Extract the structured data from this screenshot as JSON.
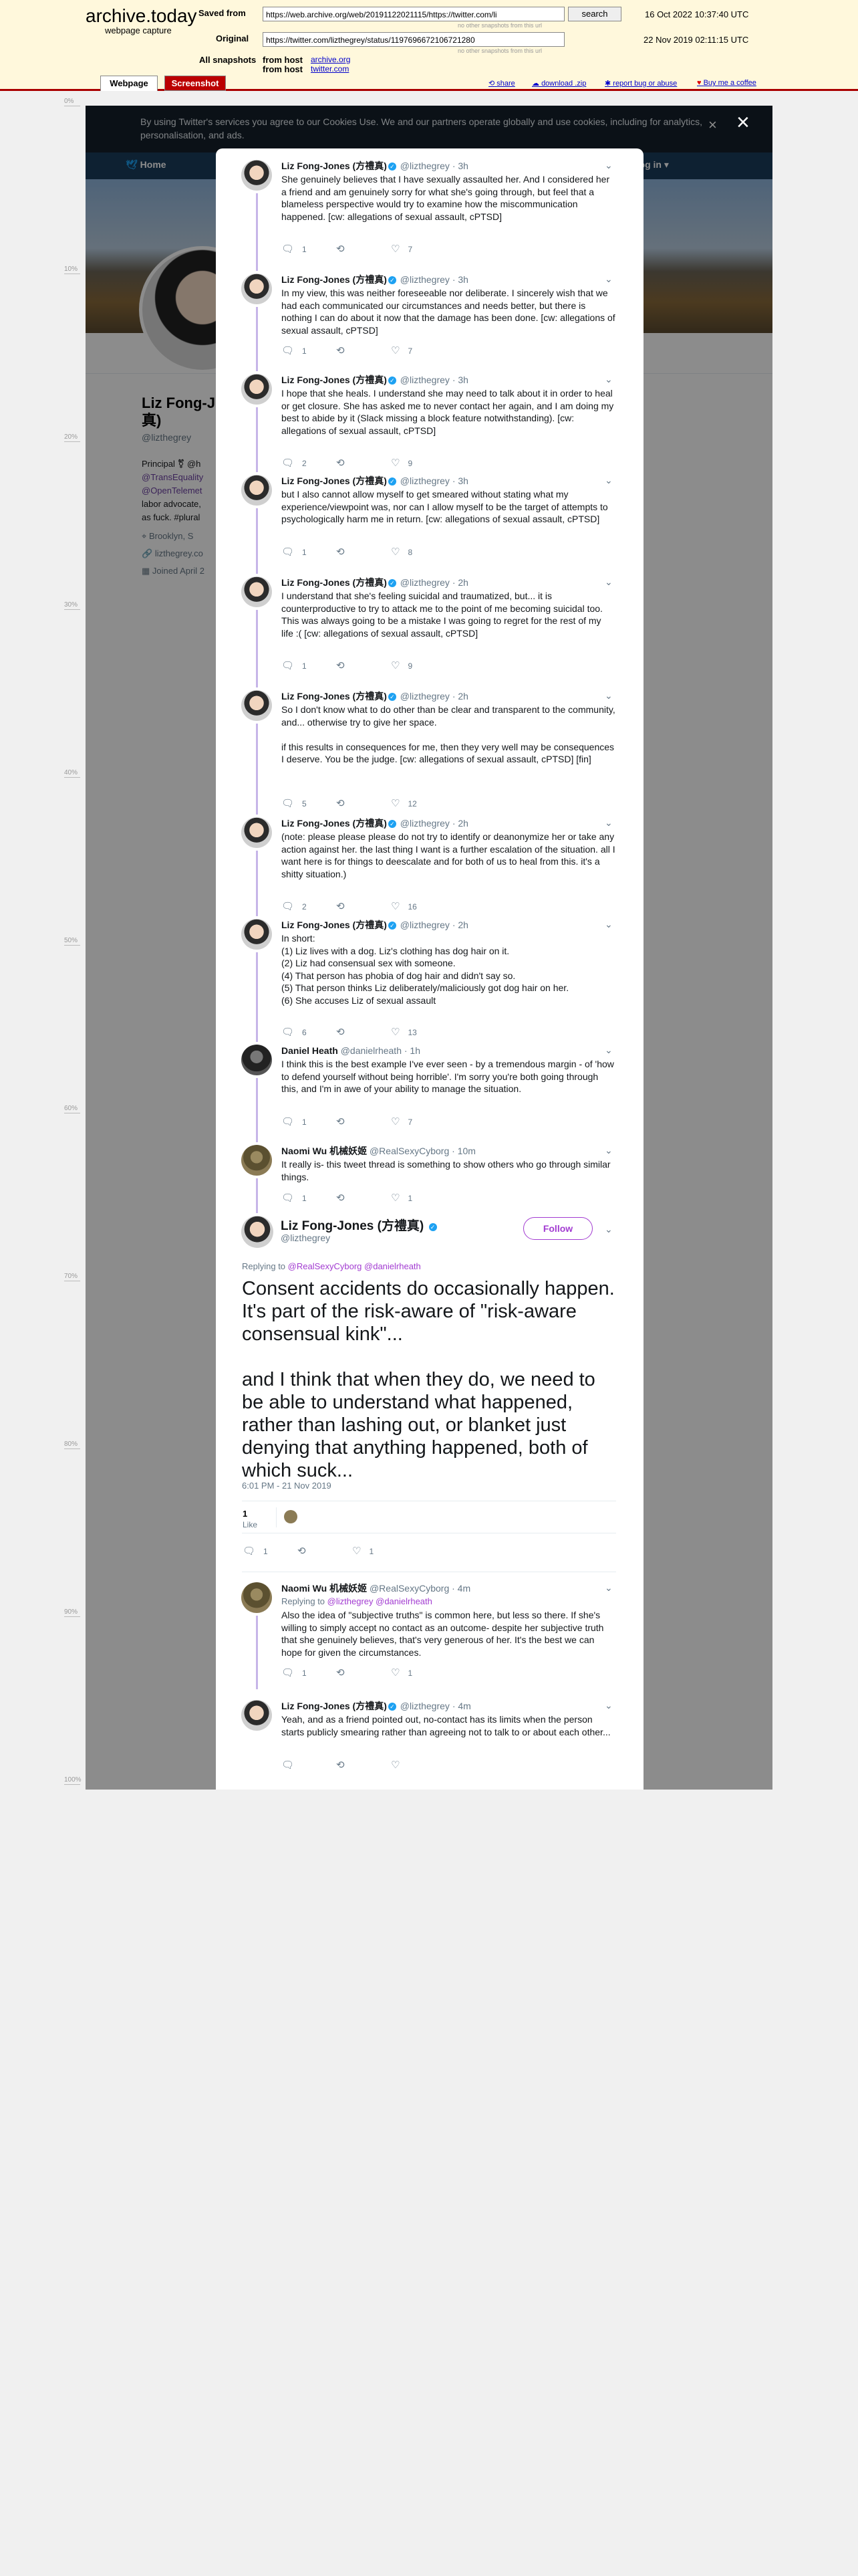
{
  "archive": {
    "title": "archive.today",
    "subtitle": "webpage capture",
    "saved_from_label": "Saved from",
    "saved_from_url": "https://web.archive.org/web/20191122021115/https://twitter.com/li",
    "search_button": "search",
    "saved_date": "16 Oct 2022 10:37:40 UTC",
    "no_other_1": "no other snapshots from this url",
    "original_label": "Original",
    "original_url": "https://twitter.com/lizthegrey/status/1197696672106721280",
    "original_date": "22 Nov 2019 02:11:15 UTC",
    "no_other_2": "no other snapshots from this url",
    "all_snapshots_label": "All snapshots",
    "from_host_1_label": "from host",
    "from_host_1": "archive.org",
    "from_host_2_label": "from host",
    "from_host_2": "twitter.com",
    "tab_webpage": "Webpage",
    "tab_screenshot": "Screenshot",
    "tool_share": "share",
    "tool_download": "download .zip",
    "tool_report": "report bug or abuse",
    "tool_coffee": "Buy me a coffee"
  },
  "ruler": [
    "0%",
    "10%",
    "20%",
    "30%",
    "40%",
    "50%",
    "60%",
    "70%",
    "80%",
    "90%",
    "100%"
  ],
  "background": {
    "cookie_text": "By using Twitter's services you agree to our Cookies Use. We and our partners operate globally and use cookies, including for analytics, personalisation, and ads.",
    "cookie_close": "×",
    "nav_home": "Home",
    "nav_login": "Log in ▾",
    "profile_name": "Liz Fong-J",
    "profile_name_2": "真)",
    "handle": "@lizthegrey",
    "bio_1": "Principal ⚧ @h",
    "bio_2": "@TransEquality",
    "bio_3": "@OpenTelemet",
    "bio_4": "labor advocate,",
    "bio_5": "as fuck. #plural",
    "location": "Brooklyn, S",
    "website": "lizthegrey.co",
    "joined": "Joined April 2"
  },
  "overlay_close": "×",
  "tweets": [
    {
      "name": "Liz Fong-Jones (方禮真)",
      "handle": "@lizthegrey",
      "time": "· 3h",
      "text": "She genuinely believes that I have sexually assaulted her. And I considered her a friend and am genuinely sorry for what she's going through, but feel that a blameless perspective would try to examine how the miscommunication happened. [cw: allegations of sexual assault, cPTSD]",
      "replies": "1",
      "retweets": "",
      "likes": "7"
    },
    {
      "name": "Liz Fong-Jones (方禮真)",
      "handle": "@lizthegrey",
      "time": "· 3h",
      "text": "In my view, this was neither foreseeable nor deliberate. I sincerely wish that we had each communicated our circumstances and needs better, but there is nothing I can do about it now that the damage has been done. [cw: allegations of sexual assault, cPTSD]",
      "replies": "1",
      "retweets": "",
      "likes": "7"
    },
    {
      "name": "Liz Fong-Jones (方禮真)",
      "handle": "@lizthegrey",
      "time": "· 3h",
      "text": "I hope that she heals. I understand she may need to talk about it in order to heal or get closure. She has asked me to never contact her again, and I am doing my best to abide by it (Slack missing a block feature notwithstanding). [cw: allegations of sexual assault, cPTSD]",
      "replies": "2",
      "retweets": "",
      "likes": "9"
    },
    {
      "name": "Liz Fong-Jones (方禮真)",
      "handle": "@lizthegrey",
      "time": "· 3h",
      "text": "but I also cannot allow myself to get smeared without stating what my experience/viewpoint was, nor can I allow myself to be the target of attempts to psychologically harm me in return. [cw: allegations of sexual assault, cPTSD]",
      "replies": "1",
      "retweets": "",
      "likes": "8"
    },
    {
      "name": "Liz Fong-Jones (方禮真)",
      "handle": "@lizthegrey",
      "time": "· 2h",
      "text": "I understand that she's feeling suicidal and traumatized, but... it is counterproductive to try to attack me to the point of me becoming suicidal too. This was always going to be a mistake I was going to regret for the rest of my life :( [cw: allegations of sexual assault, cPTSD]",
      "replies": "1",
      "retweets": "",
      "likes": "9"
    },
    {
      "name": "Liz Fong-Jones (方禮真)",
      "handle": "@lizthegrey",
      "time": "· 2h",
      "text": "So I don't know what to do other than be clear and transparent to the community, and... otherwise try to give her space.\n\nif this results in consequences for me, then they very well may be consequences I deserve. You be the judge. [cw: allegations of sexual assault, cPTSD] [fin]",
      "replies": "5",
      "retweets": "",
      "likes": "12"
    },
    {
      "name": "Liz Fong-Jones (方禮真)",
      "handle": "@lizthegrey",
      "time": "· 2h",
      "text": "(note: please please please do not try to identify or deanonymize her or take any action against her. the last thing I want is a further escalation of the situation. all I want here is for things to deescalate and for both of us to heal from this. it's a shitty situation.)",
      "replies": "2",
      "retweets": "",
      "likes": "16"
    },
    {
      "name": "Liz Fong-Jones (方禮真)",
      "handle": "@lizthegrey",
      "time": "· 2h",
      "text": "In short:\n(1) Liz lives with a dog. Liz's clothing has dog hair on it.\n(2) Liz had consensual sex with someone.\n(4) That person has phobia of dog hair and didn't say so.\n(5) That person thinks Liz deliberately/maliciously got dog hair on her.\n(6) She accuses Liz of sexual assault",
      "replies": "6",
      "retweets": "",
      "likes": "13"
    },
    {
      "name": "Daniel Heath",
      "handle": "@danielrheath",
      "time": "· 1h",
      "text": "I think this is the best example I've ever seen - by a tremendous margin - of 'how to defend yourself without being horrible'. I'm sorry you're both going through this, and I'm in awe of your ability to manage the situation.",
      "replies": "1",
      "retweets": "",
      "likes": "7"
    },
    {
      "name": "Naomi Wu 机械妖姬",
      "handle": "@RealSexyCyborg",
      "time": "· 10m",
      "text": "It really is- this tweet thread is something to show others who go through similar things.",
      "replies": "1",
      "retweets": "",
      "likes": "1"
    }
  ],
  "focus": {
    "name": "Liz Fong-Jones (方禮真)",
    "handle": "@lizthegrey",
    "follow": "Follow",
    "replying_prefix": "Replying to",
    "replying_to": "@RealSexyCyborg @danielrheath",
    "text": "Consent accidents do occasionally happen. It's part of the risk-aware of \"risk-aware consensual kink\"...\n\nand I think that when they do, we need to be able to understand what happened, rather than lashing out, or blanket just denying that anything happened, both of which suck...",
    "timestamp": "6:01 PM - 21 Nov 2019",
    "like_count": "1",
    "like_label": "Like",
    "replies": "1",
    "retweets": "",
    "likes": "1"
  },
  "replies": [
    {
      "name": "Naomi Wu 机械妖姬",
      "handle": "@RealSexyCyborg",
      "time": "· 4m",
      "replying_prefix": "Replying to",
      "replying_to": "@lizthegrey @danielrheath",
      "text": "Also the idea of \"subjective truths\" is common here, but less so there. If she's willing to simply accept no contact as an outcome- despite her subjective truth that she genuinely believes, that's very generous of her. It's the best we can hope for given the circumstances.",
      "replies": "1",
      "retweets": "",
      "likes": "1"
    },
    {
      "name": "Liz Fong-Jones (方禮真)",
      "handle": "@lizthegrey",
      "time": "· 4m",
      "text": "Yeah, and as a friend pointed out, no-contact has its limits when the person starts publicly smearing rather than agreeing not to talk to or about each other...",
      "replies": "",
      "retweets": "",
      "likes": ""
    }
  ],
  "colors": {
    "archive_bg": "#fff8dc",
    "archive_border": "#aa0000",
    "thread_line": "#c6b5e8",
    "link_purple": "#a23bd1",
    "verified": "#1da1f2"
  }
}
